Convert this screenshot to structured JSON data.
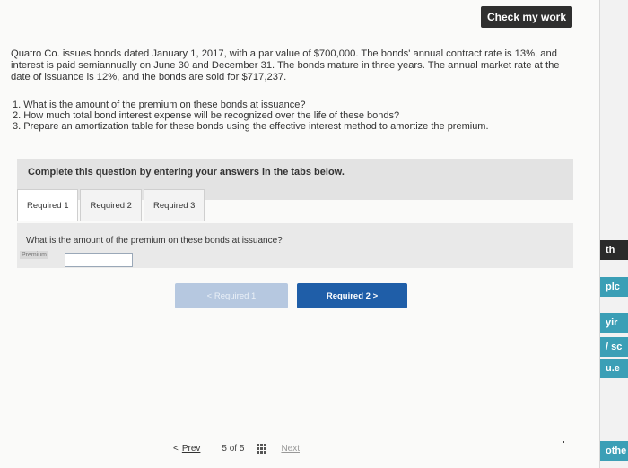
{
  "header": {
    "check_label": "Check my work"
  },
  "problem": {
    "text": "Quatro Co. issues bonds dated January 1, 2017, with a par value of $700,000. The bonds' annual contract rate is 13%, and interest is paid semiannually on June 30 and December 31. The bonds mature in three years. The annual market rate at the date of issuance is 12%, and the bonds are sold for $717,237."
  },
  "questions": [
    "1. What is the amount of the premium on these bonds at issuance?",
    "2. How much total bond interest expense will be recognized over the life of these bonds?",
    "3. Prepare an amortization table for these bonds using the effective interest method to amortize the premium."
  ],
  "instruction": "Complete this question by entering your answers in the tabs below.",
  "tabs": [
    {
      "label": "Required 1"
    },
    {
      "label": "Required 2"
    },
    {
      "label": "Required 3"
    }
  ],
  "content": {
    "question": "What is the amount of the premium on these bonds at issuance?",
    "premium_label": "Premium",
    "premium_value": ""
  },
  "nav": {
    "prev_label": "< Required 1",
    "next_label": "Required 2 >"
  },
  "pager": {
    "prev_arrow": "<",
    "prev_label": "Prev",
    "count": "5 of 5",
    "next_label": "Next"
  },
  "side": [
    "th",
    "plc",
    "yir",
    "/ sc",
    "u.e",
    "othe"
  ],
  "colors": {
    "accent": "#1f5ea8",
    "accent_disabled": "#b6c8e0",
    "check_button": "#2f2f2f",
    "side_chip": "#3b9fb6"
  }
}
